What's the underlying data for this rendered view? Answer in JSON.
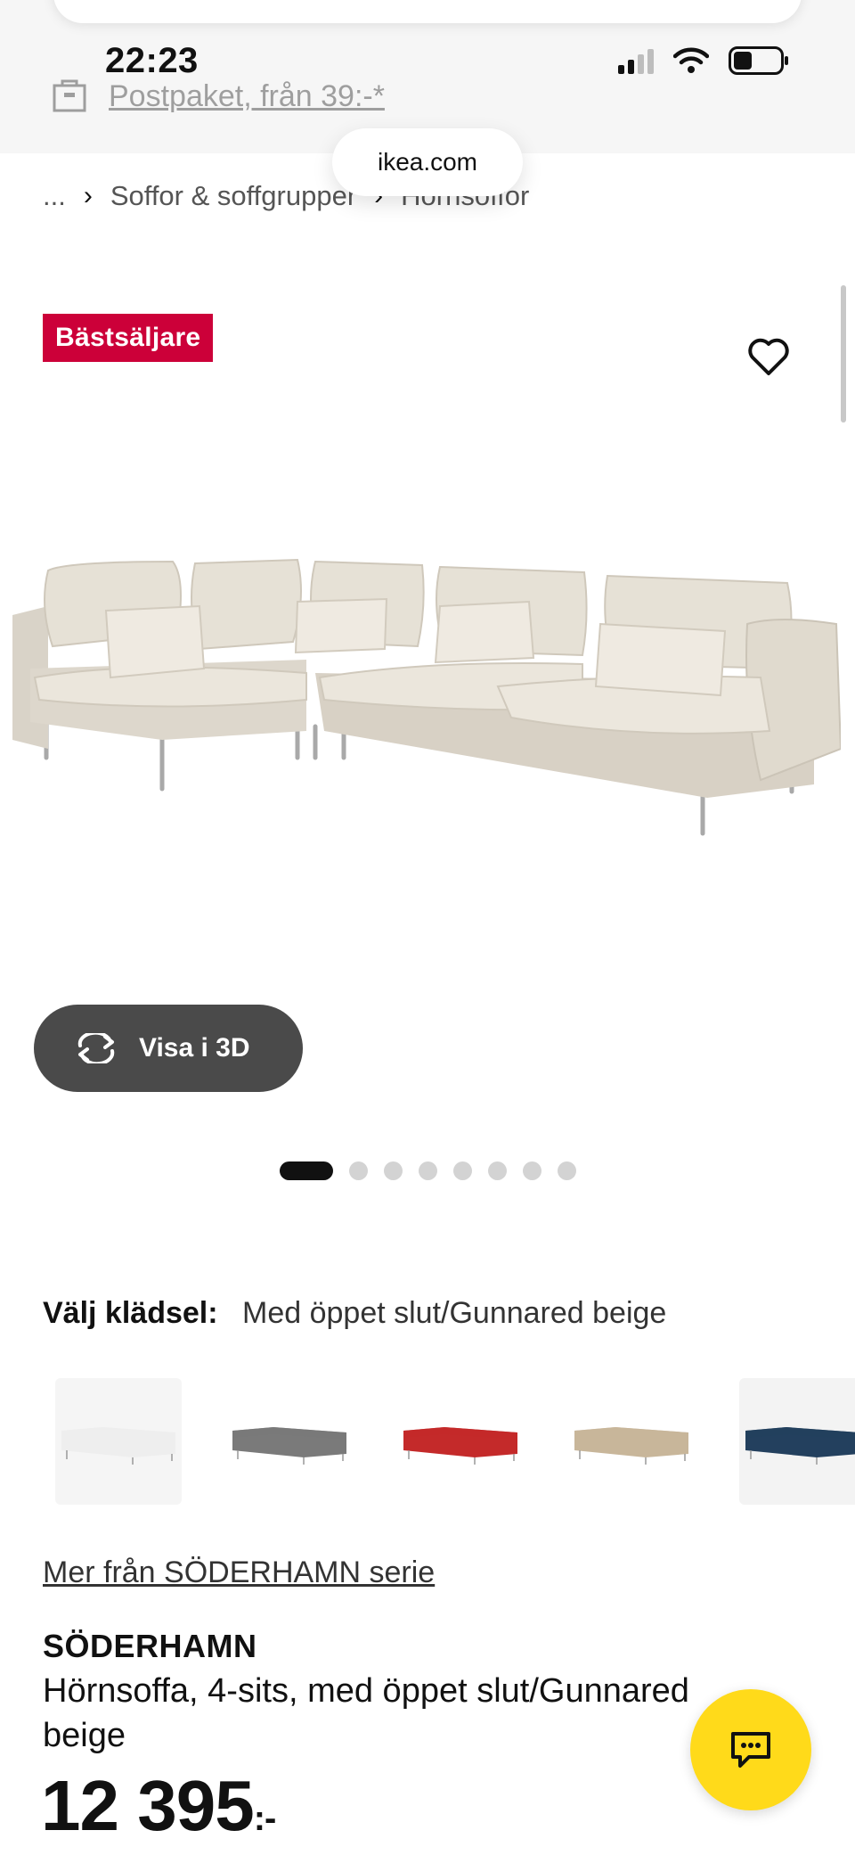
{
  "status_bar": {
    "time": "22:23"
  },
  "promo": {
    "text": "Postpaket, från 39:-*"
  },
  "browser": {
    "url": "ikea.com"
  },
  "breadcrumb": {
    "ellipsis": "...",
    "items": [
      "Soffor & soffgrupper",
      "Hörnsoffor"
    ]
  },
  "product": {
    "badge": "Bästsäljare",
    "view_3d_label": "Visa i 3D",
    "gallery": {
      "total": 8,
      "active_index": 0
    },
    "upholstery": {
      "label": "Välj klädsel:",
      "value": "Med öppet slut/Gunnared beige"
    },
    "swatches": [
      {
        "name": "white",
        "color": "#eeeeee",
        "selected": true
      },
      {
        "name": "grey",
        "color": "#7a7a7a",
        "selected": false
      },
      {
        "name": "red",
        "color": "#c42a2a",
        "selected": false
      },
      {
        "name": "beige",
        "color": "#c8b69a",
        "selected": false
      },
      {
        "name": "blue",
        "color": "#23405e",
        "selected": false
      }
    ],
    "series_link": "Mer från SÖDERHAMN serie",
    "name": "SÖDERHAMN",
    "description": "Hörnsoffa, 4-sits, med öppet slut/Gunnared beige",
    "price": {
      "amount": "12 395",
      "suffix": ":-"
    }
  },
  "colors": {
    "badge": "#cc0039",
    "chat": "#ffda1a",
    "button_3d": "#4a4a4a"
  }
}
